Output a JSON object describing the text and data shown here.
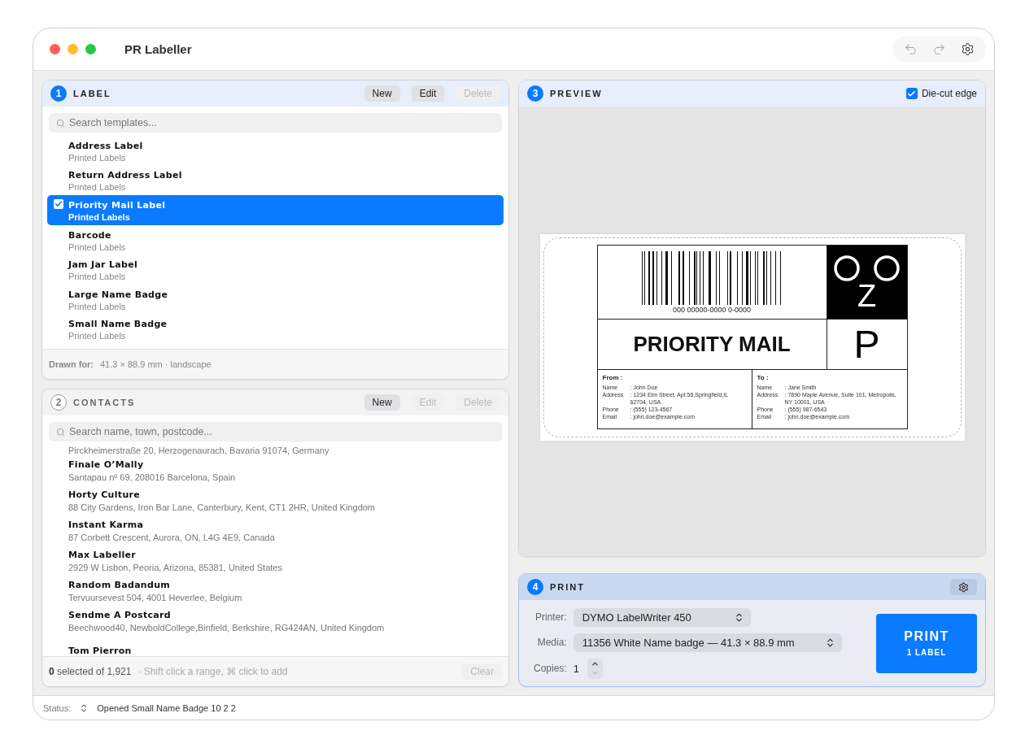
{
  "window": {
    "title": "PR Labeller"
  },
  "toolbar": [
    {
      "kind": "undo",
      "disabled": true
    },
    {
      "kind": "redo",
      "disabled": true
    },
    {
      "kind": "settings",
      "disabled": false
    }
  ],
  "label_panel": {
    "step": "1",
    "title": "LABEL",
    "active": true,
    "buttons": [
      {
        "label": "New",
        "disabled": false
      },
      {
        "label": "Edit",
        "disabled": false
      },
      {
        "label": "Delete",
        "disabled": true
      }
    ],
    "search": {
      "placeholder": "Search templates..."
    },
    "templates": [
      {
        "name": "Address Label",
        "category": "Printed Labels",
        "selected": false
      },
      {
        "name": "Return Address Label",
        "category": "Printed Labels",
        "selected": false
      },
      {
        "name": "Priority Mail Label",
        "category": "Printed Labels",
        "selected": true
      },
      {
        "name": "Barcode",
        "category": "Printed Labels",
        "selected": false
      },
      {
        "name": "Jam Jar Label",
        "category": "Printed Labels",
        "selected": false
      },
      {
        "name": "Large Name Badge",
        "category": "Printed Labels",
        "selected": false
      },
      {
        "name": "Small Name Badge",
        "category": "Printed Labels",
        "selected": false
      }
    ],
    "footer_label": "Drawn for:",
    "footer_value": "41.3 × 88.9 mm · landscape"
  },
  "contacts_panel": {
    "step": "2",
    "title": "CONTACTS",
    "active": false,
    "buttons": [
      {
        "label": "New",
        "disabled": false
      },
      {
        "label": "Edit",
        "disabled": true
      },
      {
        "label": "Delete",
        "disabled": true
      }
    ],
    "search": {
      "placeholder": "Search name, town, postcode..."
    },
    "contacts": [
      {
        "address": "Pirckheimerstraße 20, Herzogenaurach, Bavaria 91074, Germany"
      },
      {
        "name": "Finale O’Mally",
        "address": "Santapau nº 69, 208016 Barcelona, Spain"
      },
      {
        "name": "Horty Culture",
        "address": "88 City Gardens, Iron Bar Lane, Canterbury, Kent, CT1 2HR, United Kingdom"
      },
      {
        "name": "Instant Karma",
        "address": "87 Corbett Crescent, Aurora, ON, L4G 4E9, Canada"
      },
      {
        "name": "Max Labeller",
        "address": "2929 W Lisbon, Peoria, Arizona, 85381, United States"
      },
      {
        "name": "Random Badandum",
        "address": "Tervuursevest 504, 4001 Heverlee, Belgium"
      },
      {
        "name": "Sendme A Postcard",
        "address": "Beechwood40, NewboldCollege,Binfield, Berkshire, RG424AN, United Kingdom"
      },
      {
        "name": "Tom Pierron"
      }
    ],
    "count": "**0** selected of 1,921",
    "hint": "· Shift click a range, ⌘ click to add",
    "clear": {
      "label": "Clear",
      "disabled": true
    }
  },
  "preview_panel": {
    "step": "3",
    "title": "PREVIEW",
    "active": true,
    "die_cut": {
      "label": "Die-cut edge",
      "checked": true
    },
    "label": {
      "barcode_number": "000 00000-0000 0-0000",
      "zone": "Z",
      "service": "PRIORITY MAIL",
      "class": "P",
      "from": {
        "heading": "From :",
        "fields": [
          {
            "key": "Name",
            "value": ": John Doe"
          },
          {
            "key": "Address",
            "value": ": 1234 Elm Street, Apt 56,Springfield,IL 62704, USA"
          },
          {
            "key": "Phone",
            "value": ": (555) 123-4567"
          },
          {
            "key": "Email",
            "value": ": john.doe@example.com"
          }
        ]
      },
      "to": {
        "heading": "To :",
        "fields": [
          {
            "key": "Name",
            "value": ": Jane Smith"
          },
          {
            "key": "Address",
            "value": ": 7890 Maple Avenue, Suite 101, Metropolis, NY 10001, USA"
          },
          {
            "key": "Phone",
            "value": ": (555) 987-6543"
          },
          {
            "key": "Email",
            "value": ": john.doe@example.com"
          }
        ]
      }
    }
  },
  "print_panel": {
    "step": "4",
    "title": "PRINT",
    "active": true,
    "printer": {
      "label": "Printer:",
      "value": "DYMO LabelWriter 450"
    },
    "media": {
      "label": "Media:",
      "value": "11356 White Name badge — 41.3 × 88.9 mm"
    },
    "copies": {
      "label": "Copies:",
      "value": "1"
    },
    "print_button": {
      "title": "PRINT",
      "subtitle": "1 LABEL"
    }
  },
  "status_bar": {
    "label": "Status:",
    "text": "Opened Small Name Badge 10 2 2"
  }
}
